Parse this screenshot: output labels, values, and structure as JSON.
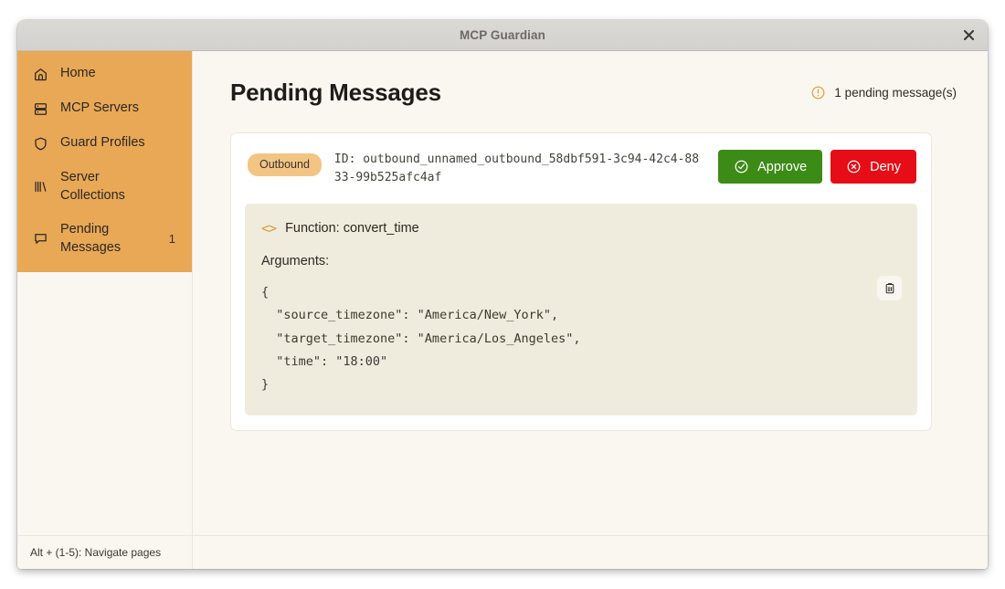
{
  "window": {
    "title": "MCP Guardian",
    "close_label": "✕",
    "close_icon": "close-icon"
  },
  "sidebar": {
    "items": [
      {
        "label": "Home",
        "icon": "home-icon",
        "badge": "",
        "active": false
      },
      {
        "label": "MCP Servers",
        "icon": "server-icon",
        "badge": "",
        "active": false
      },
      {
        "label": "Guard Profiles",
        "icon": "shield-icon",
        "badge": "",
        "active": false
      },
      {
        "label": "Server Collections",
        "icon": "collections-icon",
        "badge": "",
        "active": false
      },
      {
        "label": "Pending Messages",
        "icon": "message-icon",
        "badge": "1",
        "active": true
      }
    ]
  },
  "main": {
    "page_title": "Pending Messages",
    "status": {
      "icon": "alert-circle-icon",
      "text": "1 pending message(s)"
    },
    "message": {
      "direction_badge": "Outbound",
      "id_text": "ID: outbound_unnamed_outbound_58dbf591-3c94-42c4-8833-99b525afc4af",
      "approve_label": "Approve",
      "approve_icon": "check-circle-icon",
      "deny_label": "Deny",
      "deny_icon": "x-circle-icon",
      "code_bracket": "<>",
      "function_line": "Function: convert_time",
      "arguments_label": "Arguments:",
      "arguments_json": "{\n  \"source_timezone\": \"America/New_York\",\n  \"target_timezone\": \"America/Los_Angeles\",\n  \"time\": \"18:00\"\n}",
      "copy_icon": "clipboard-icon",
      "copy_glyph": "📋"
    }
  },
  "footer": {
    "hint": "Alt + (1-5): Navigate pages"
  },
  "colors": {
    "sidebar_orange": "#e8a856",
    "badge_orange": "#f2c584",
    "approve_green": "#3d8b17",
    "deny_red": "#e60d16",
    "page_background": "#faf7f0",
    "code_background": "#efecde",
    "accent_amber": "#e0a23f"
  }
}
